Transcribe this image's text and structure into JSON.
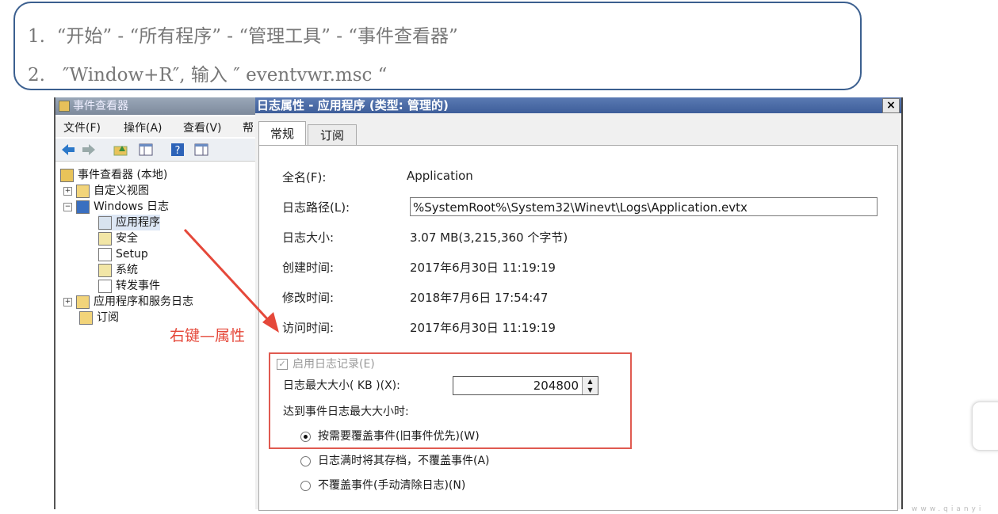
{
  "instructions": [
    "1.  “开始” - “所有程序” - “管理工具” - “事件查看器”",
    "2.   ″Window+R″, 输入 ″ eventvwr.msc “"
  ],
  "event_viewer": {
    "title": "事件查看器",
    "menu": [
      "文件(F)",
      "操作(A)",
      "查看(V)",
      "帮"
    ],
    "tree": {
      "root": "事件查看器 (本地)",
      "custom_views": "自定义视图",
      "windows_logs": "Windows 日志",
      "application": "应用程序",
      "security": "安全",
      "setup": "Setup",
      "system": "系统",
      "forwarded": "转发事件",
      "app_service_logs": "应用程序和服务日志",
      "subscriptions": "订阅"
    },
    "annotation": "右键—属性"
  },
  "dialog": {
    "title": "日志属性 - 应用程序 (类型: 管理的)",
    "close": "×",
    "tabs": [
      "常规",
      "订阅"
    ],
    "full_name_label": "全名(F):",
    "full_name_value": "Application",
    "log_path_label": "日志路径(L):",
    "log_path_value": "%SystemRoot%\\System32\\Winevt\\Logs\\Application.evtx",
    "log_size_label": "日志大小:",
    "log_size_value": "3.07 MB(3,215,360 个字节)",
    "created_label": "创建时间:",
    "created_value": "2017年6月30日 11:19:19",
    "modified_label": "修改时间:",
    "modified_value": "2018年7月6日 17:54:47",
    "accessed_label": "访问时间:",
    "accessed_value": "2017年6月30日 11:19:19",
    "enable_logging": "启用日志记录(E)",
    "max_size_label": "日志最大大小( KB )(X):",
    "max_size_value": "204800",
    "on_max_label": "达到事件日志最大大小时:",
    "option_overwrite": "按需要覆盖事件(旧事件优先)(W)",
    "option_archive": "日志满时将其存档，不覆盖事件(A)",
    "option_manual": "不覆盖事件(手动清除日志)(N)",
    "selected_option": "option_overwrite"
  },
  "watermark": "www.qianyi",
  "colors": {
    "annotation_red": "#e5483a",
    "title_blue": "#3e5e9a",
    "instruction_border": "#3b5f8f"
  }
}
